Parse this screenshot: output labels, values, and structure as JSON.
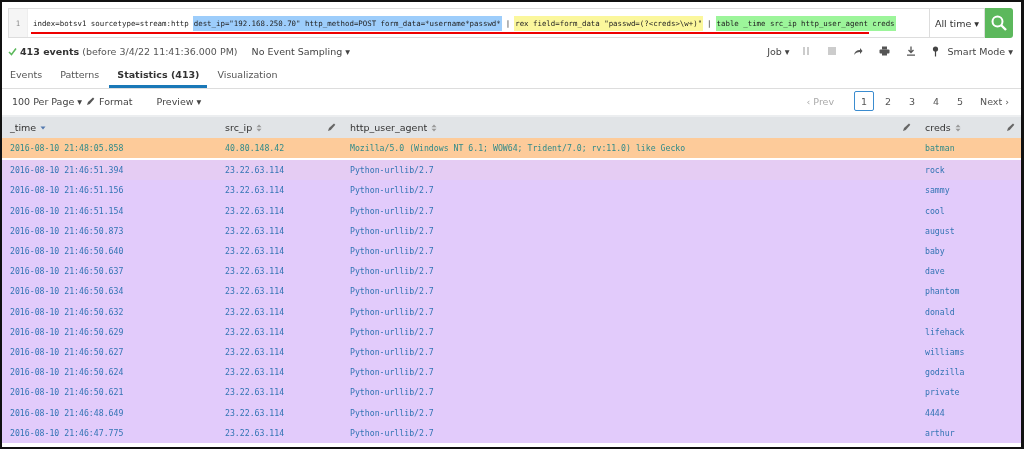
{
  "search": {
    "line_number": "1",
    "segments": [
      {
        "text": "index=botsv1 sourcetype=stream:http",
        "color": "#ffffff"
      },
      {
        "text": "dest_ip=\"192.168.250.70\" http_method=POST form_data=*username*passwd*",
        "color": "#9dcdfb"
      },
      {
        "text": "|",
        "color": "#ffffff"
      },
      {
        "text": "rex field=form_data \"passwd=(?<creds>\\w+)\"",
        "color": "#fbf79c"
      },
      {
        "text": "|",
        "color": "#ffffff"
      },
      {
        "text": "table _time src_ip http_user_agent creds",
        "color": "#9cf59a"
      }
    ],
    "time_range": "All time ▾"
  },
  "status": {
    "count": "413 events",
    "detail": "(before 3/4/22 11:41:36.000 PM)",
    "sampling": "No Event Sampling ▾"
  },
  "job": {
    "label": "Job ▾",
    "mode": "Smart Mode ▾"
  },
  "tabs": [
    {
      "label": "Events",
      "selected": false
    },
    {
      "label": "Patterns",
      "selected": false
    },
    {
      "label": "Statistics (413)",
      "selected": true
    },
    {
      "label": "Visualization",
      "selected": false
    }
  ],
  "options": {
    "per_page": "100 Per Page ▾",
    "format": "Format",
    "preview": "Preview ▾"
  },
  "pagination": {
    "prev": "‹ Prev",
    "next": "Next ›",
    "pages": [
      {
        "label": "1",
        "selected": true
      },
      {
        "label": "2",
        "selected": false
      },
      {
        "label": "3",
        "selected": false
      },
      {
        "label": "4",
        "selected": false
      },
      {
        "label": "5",
        "selected": false
      }
    ]
  },
  "table": {
    "columns": [
      "_time",
      "src_ip",
      "http_user_agent",
      "creds"
    ],
    "rows": [
      {
        "cells": [
          "2016-08-10 21:48:05.858",
          "40.80.148.42",
          "Mozilla/5.0 (Windows NT 6.1; WOW64; Trident/7.0; rv:11.0) like Gecko",
          "batman"
        ],
        "color": "#fdcb9a"
      },
      {
        "cells": [
          "2016-08-10 21:46:51.394",
          "23.22.63.114",
          "Python-urllib/2.7",
          "rock"
        ],
        "color": "#e5ccf3"
      },
      {
        "cells": [
          "2016-08-10 21:46:51.156",
          "23.22.63.114",
          "Python-urllib/2.7",
          "sammy"
        ],
        "color": "#e2cbfb"
      },
      {
        "cells": [
          "2016-08-10 21:46:51.154",
          "23.22.63.114",
          "Python-urllib/2.7",
          "cool"
        ],
        "color": "#e2cbfb"
      },
      {
        "cells": [
          "2016-08-10 21:46:50.873",
          "23.22.63.114",
          "Python-urllib/2.7",
          "august"
        ],
        "color": "#e2cbfb"
      },
      {
        "cells": [
          "2016-08-10 21:46:50.640",
          "23.22.63.114",
          "Python-urllib/2.7",
          "baby"
        ],
        "color": "#e2cbfb"
      },
      {
        "cells": [
          "2016-08-10 21:46:50.637",
          "23.22.63.114",
          "Python-urllib/2.7",
          "dave"
        ],
        "color": "#e2cbfb"
      },
      {
        "cells": [
          "2016-08-10 21:46:50.634",
          "23.22.63.114",
          "Python-urllib/2.7",
          "phantom"
        ],
        "color": "#e2cbfb"
      },
      {
        "cells": [
          "2016-08-10 21:46:50.632",
          "23.22.63.114",
          "Python-urllib/2.7",
          "donald"
        ],
        "color": "#e2cbfb"
      },
      {
        "cells": [
          "2016-08-10 21:46:50.629",
          "23.22.63.114",
          "Python-urllib/2.7",
          "lifehack"
        ],
        "color": "#e2cbfb"
      },
      {
        "cells": [
          "2016-08-10 21:46:50.627",
          "23.22.63.114",
          "Python-urllib/2.7",
          "williams"
        ],
        "color": "#e2cbfb"
      },
      {
        "cells": [
          "2016-08-10 21:46:50.624",
          "23.22.63.114",
          "Python-urllib/2.7",
          "godzilla"
        ],
        "color": "#e2cbfb"
      },
      {
        "cells": [
          "2016-08-10 21:46:50.621",
          "23.22.63.114",
          "Python-urllib/2.7",
          "private"
        ],
        "color": "#e2cbfb"
      },
      {
        "cells": [
          "2016-08-10 21:46:48.649",
          "23.22.63.114",
          "Python-urllib/2.7",
          "4444"
        ],
        "color": "#e2cbfb"
      },
      {
        "cells": [
          "2016-08-10 21:46:47.775",
          "23.22.63.114",
          "Python-urllib/2.7",
          "arthur"
        ],
        "color": "#e2cbfb"
      }
    ]
  }
}
